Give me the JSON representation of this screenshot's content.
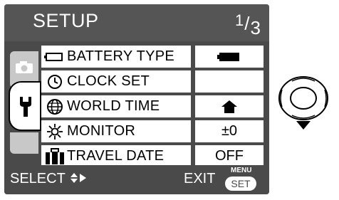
{
  "header": {
    "title": "SETUP",
    "page_current": "1",
    "page_total": "3"
  },
  "tabs": [
    {
      "icon": "camera-icon"
    },
    {
      "icon": "wrench-icon",
      "selected": true
    }
  ],
  "menu": {
    "items": [
      {
        "label": "BATTERY TYPE",
        "value": "",
        "icon": "battery-icon"
      },
      {
        "label": "CLOCK SET",
        "value": "",
        "icon": "clock-icon"
      },
      {
        "label": "WORLD TIME",
        "value": "",
        "icon": "globe-icon"
      },
      {
        "label": "MONITOR",
        "value": "±0",
        "icon": "brightness-icon"
      },
      {
        "label": "TRAVEL DATE",
        "value": "OFF",
        "icon": "suitcase-icon"
      }
    ]
  },
  "footer": {
    "select_label": "SELECT",
    "exit_label": "EXIT",
    "menu_label": "MENU",
    "set_label": "SET"
  }
}
